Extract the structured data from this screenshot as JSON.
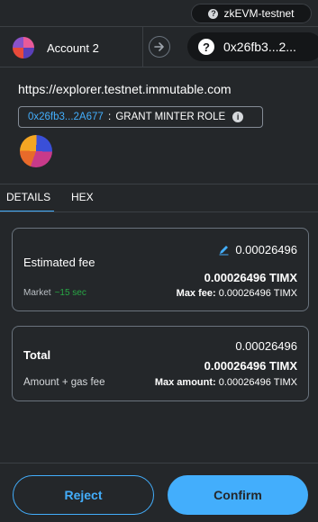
{
  "network": {
    "name": "zkEVM-testnet",
    "icon": "question-icon"
  },
  "header": {
    "from_account": "Account 2",
    "to_address": "0x26fb3...2..."
  },
  "origin": "https://explorer.testnet.immutable.com",
  "method": {
    "address": "0x26fb3...2A677",
    "separator": " : ",
    "name": "GRANT MINTER ROLE"
  },
  "tabs": [
    {
      "label": "DETAILS",
      "active": true
    },
    {
      "label": "HEX",
      "active": false
    }
  ],
  "fee_card": {
    "title": "Estimated fee",
    "amount": "0.00026496",
    "amount_timx": "0.00026496 TIMX",
    "market_label": "Market",
    "market_time": "~15 sec",
    "max_fee_label": "Max fee:",
    "max_fee_value": "0.00026496 TIMX"
  },
  "total_card": {
    "title": "Total",
    "amount": "0.00026496",
    "amount_timx": "0.00026496 TIMX",
    "subtitle": "Amount + gas fee",
    "max_amount_label": "Max amount:",
    "max_amount_value": "0.00026496 TIMX"
  },
  "buttons": {
    "reject": "Reject",
    "confirm": "Confirm"
  },
  "colors": {
    "accent": "#43aefc",
    "background": "#24272a",
    "success": "#28a745"
  }
}
